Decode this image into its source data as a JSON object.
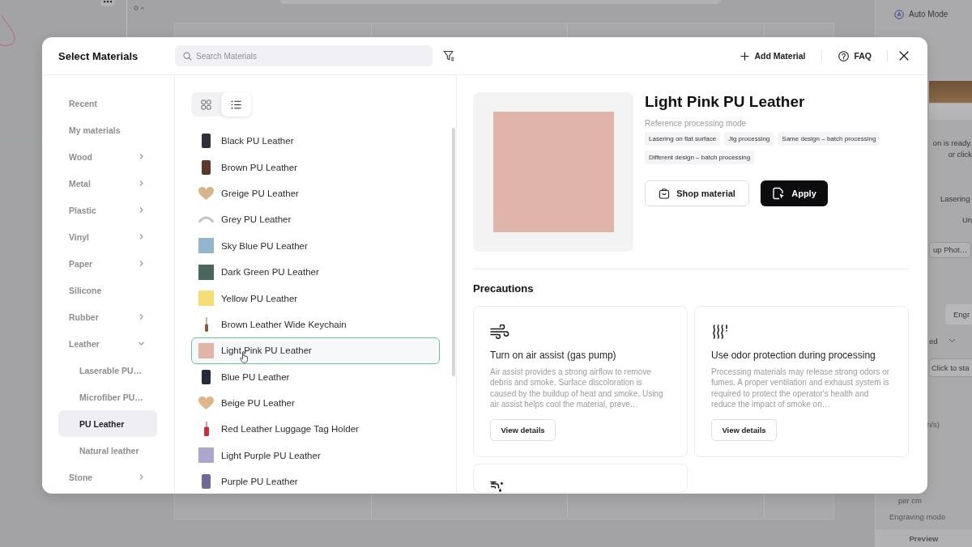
{
  "background_app": {
    "mode_label": "Auto Mode",
    "status_lines": [
      "on is ready.",
      "or click"
    ],
    "setting_values": [
      "Lasering",
      "Un"
    ],
    "photo_button": "up Phot…",
    "tab": "Engr",
    "dropdown_value": "ed",
    "start_button": "Click to sta",
    "speed_unit": "n/s)",
    "density_unit": "per cm",
    "engraving_mode_label": "Engraving mode",
    "preview_button": "Preview"
  },
  "dialog": {
    "title": "Select Materials",
    "search": {
      "placeholder": "Search Materials"
    },
    "actions": [
      {
        "label": "Add Material",
        "kind": "add"
      },
      {
        "label": "FAQ",
        "kind": "help"
      }
    ]
  },
  "sidebar": {
    "items": [
      {
        "label": "Recent",
        "selected": false
      },
      {
        "label": "My materials",
        "selected": false
      },
      {
        "label": "Wood",
        "expanded": false,
        "selected": false
      },
      {
        "label": "Metal",
        "expanded": false,
        "selected": false
      },
      {
        "label": "Plastic",
        "expanded": false,
        "selected": false
      },
      {
        "label": "Vinyl",
        "expanded": false,
        "selected": false
      },
      {
        "label": "Paper",
        "expanded": false,
        "selected": false
      },
      {
        "label": "Silicone",
        "selected": false
      },
      {
        "label": "Rubber",
        "expanded": false,
        "selected": false
      },
      {
        "label": "Leather",
        "expanded": true,
        "selected": false,
        "children": [
          {
            "label": "Laserable PU…",
            "selected": false
          },
          {
            "label": "Microfiber PU…",
            "selected": false
          },
          {
            "label": "PU Leather",
            "selected": true
          },
          {
            "label": "Natural leather",
            "selected": false
          }
        ]
      },
      {
        "label": "Stone",
        "expanded": false,
        "selected": false
      }
    ]
  },
  "view_toggle": [
    {
      "kind": "grid",
      "selected": false
    },
    {
      "kind": "list",
      "selected": true
    }
  ],
  "materials": [
    {
      "name": "Black PU Leather",
      "kind": "case",
      "color": "#2f3038",
      "selected": false
    },
    {
      "name": "Brown PU Leather",
      "kind": "case",
      "color": "#5b3a2c",
      "selected": false
    },
    {
      "name": "Greige PU Leather",
      "kind": "heart",
      "color": "#d6b48c",
      "selected": false
    },
    {
      "name": "Grey PU Leather",
      "kind": "arc",
      "color": "#c4c4c6",
      "selected": false
    },
    {
      "name": "Sky Blue PU Leather",
      "kind": "square",
      "color": "#93b5cd",
      "selected": false
    },
    {
      "name": "Dark Green PU Leather",
      "kind": "square",
      "color": "#4b6661",
      "selected": false
    },
    {
      "name": "Yellow PU Leather",
      "kind": "square",
      "color": "#f5de78",
      "selected": false
    },
    {
      "name": "Brown Leather Wide Keychain",
      "kind": "keychain",
      "color": "#8b5a3c",
      "selected": false
    },
    {
      "name": "Light Pink PU Leather",
      "kind": "square",
      "color": "#e0b5a9",
      "selected": true
    },
    {
      "name": "Blue PU Leather",
      "kind": "case",
      "color": "#262b3b",
      "selected": false
    },
    {
      "name": "Beige PU Leather",
      "kind": "heart",
      "color": "#deb68c",
      "selected": false
    },
    {
      "name": "Red Leather Luggage Tag Holder",
      "kind": "tag",
      "color": "#c5303f",
      "selected": false
    },
    {
      "name": "Light Purple PU Leather",
      "kind": "square",
      "color": "#aea7cb",
      "selected": false
    },
    {
      "name": "Purple PU Leather",
      "kind": "case",
      "color": "#6f6a96",
      "selected": false
    }
  ],
  "detail": {
    "title": "Light Pink PU Leather",
    "mode_label": "Reference processing mode",
    "tags": [
      "Lasering on flat surface",
      "Jig processing",
      "Same design – batch processing",
      "Different design – batch processing"
    ],
    "buttons": [
      {
        "label": "Shop material",
        "kind": "shop"
      },
      {
        "label": "Apply",
        "kind": "apply"
      }
    ]
  },
  "precautions": {
    "title": "Precautions",
    "cards": [
      {
        "kind": "airflow",
        "title": "Turn on air assist (gas pump)",
        "text": "Air assist provides a strong airflow to remove debris and smoke. Surface discoloration is caused by the buildup of heat and smoke. Using air assist helps cool the material, preve…",
        "button": "View details"
      },
      {
        "kind": "odor",
        "title": "Use odor protection during processing",
        "text": "Processing materials may release strong odors or fumes. A proper ventilation and exhaust system is required to protect the operator's health and reduce the impact of smoke on…",
        "button": "View details"
      },
      {
        "kind": "water"
      }
    ]
  }
}
